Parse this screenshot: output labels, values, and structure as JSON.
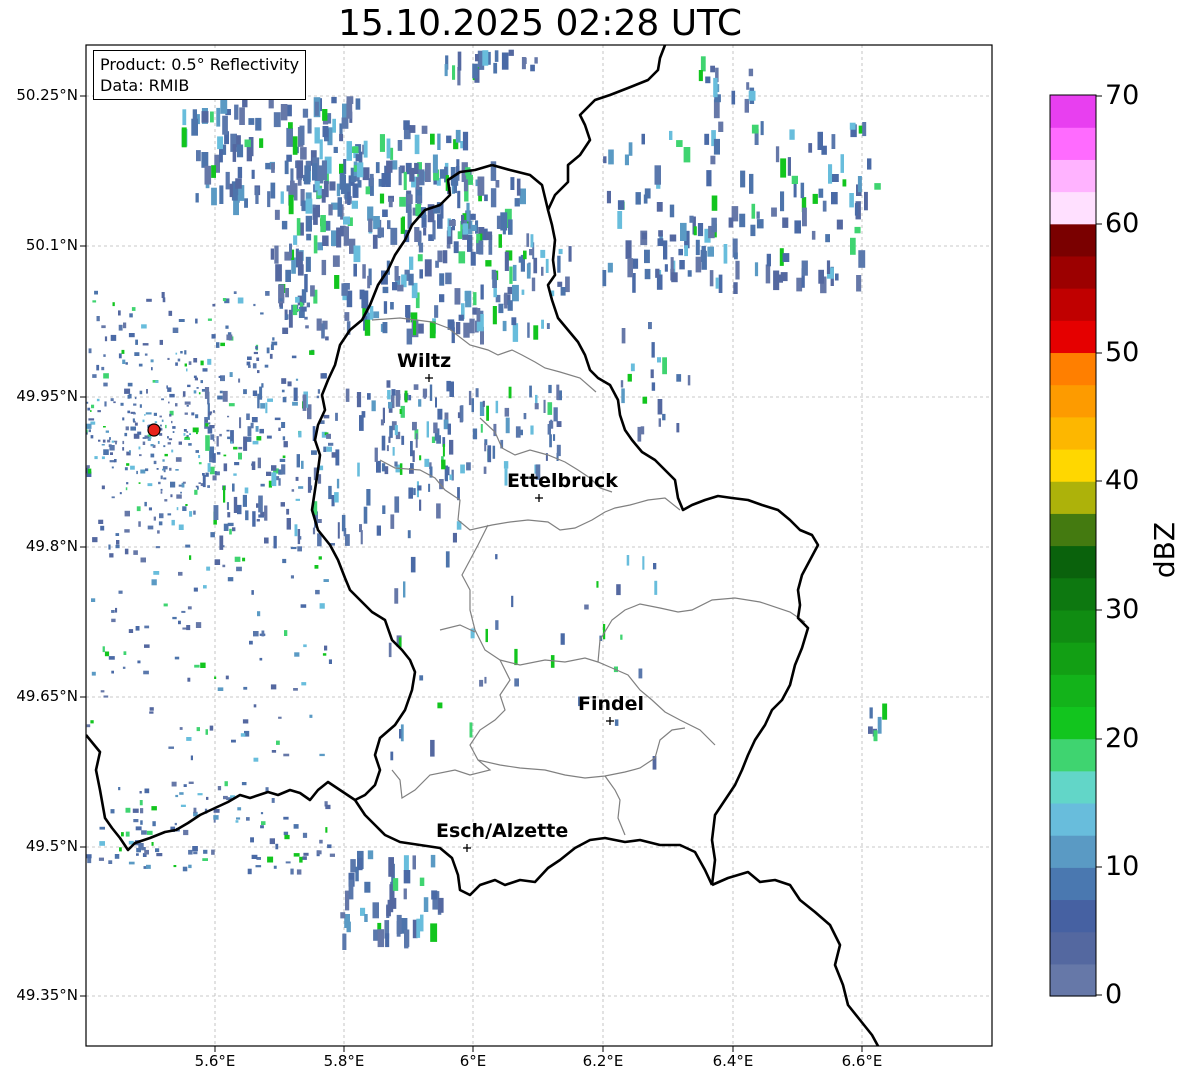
{
  "title": "15.10.2025 02:28 UTC",
  "legend": {
    "product": "Product: 0.5° Reflectivity",
    "source": "Data: RMIB"
  },
  "lat_ticks": [
    "50.25°N",
    "50.1°N",
    "49.95°N",
    "49.8°N",
    "49.65°N",
    "49.5°N",
    "49.35°N"
  ],
  "lon_ticks": [
    "5.6°E",
    "5.8°E",
    "6°E",
    "6.2°E",
    "6.4°E",
    "6.6°E"
  ],
  "cities": [
    {
      "name": "Wiltz"
    },
    {
      "name": "Ettelbruck"
    },
    {
      "name": "Findel"
    },
    {
      "name": "Esch/Alzette"
    }
  ],
  "radar_site": {
    "color": "#e8231c"
  },
  "colorbar": {
    "label": "dBZ",
    "ticks": [
      "70",
      "60",
      "50",
      "40",
      "30",
      "20",
      "10",
      "0"
    ],
    "range": [
      0,
      70
    ],
    "step": 2.5,
    "colors": [
      "#6678a8",
      "#5468a0",
      "#4661a2",
      "#4a78b0",
      "#5a9ac4",
      "#68bddc",
      "#62d6c8",
      "#3fd470",
      "#12c51e",
      "#13b31a",
      "#129f14",
      "#108c12",
      "#0d7810",
      "#0a620c",
      "#447a10",
      "#adb20a",
      "#ffd700",
      "#fdb700",
      "#fd9b00",
      "#ff7f00",
      "#e50000",
      "#c00000",
      "#9c0000",
      "#7a0000",
      "#ffe0ff",
      "#ffb3ff",
      "#ff6bff",
      "#e83ff0"
    ]
  },
  "gridlines": true
}
